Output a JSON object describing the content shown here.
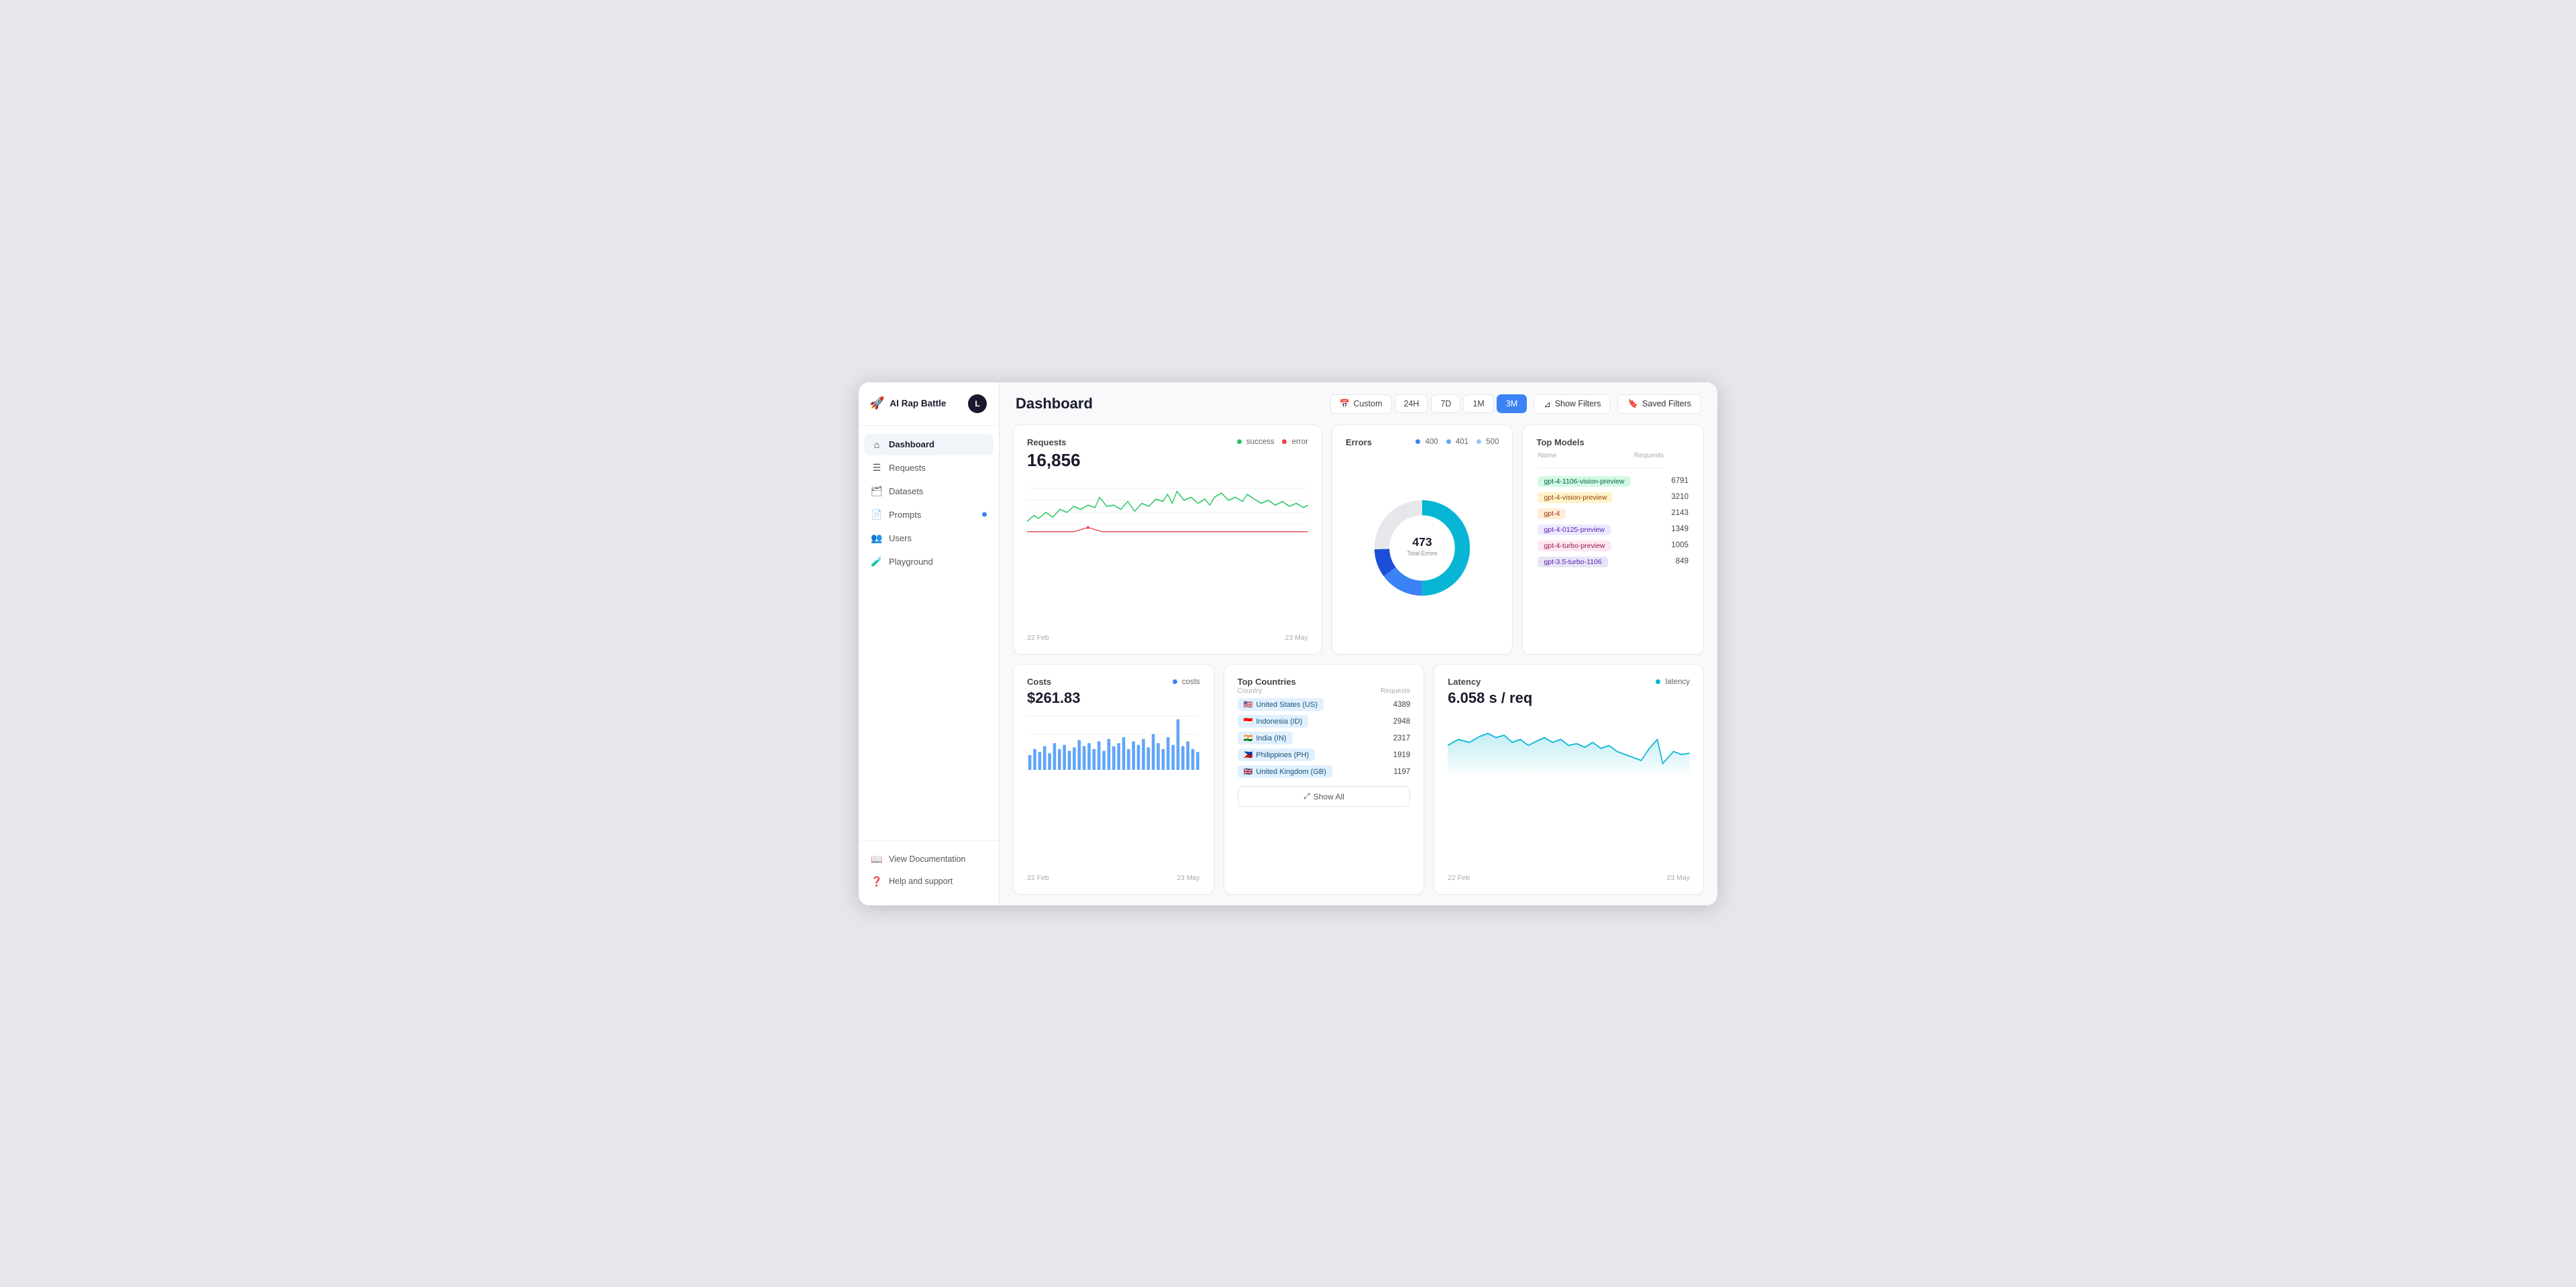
{
  "app": {
    "name": "AI Rap Battle",
    "avatar": "L"
  },
  "sidebar": {
    "nav_items": [
      {
        "id": "dashboard",
        "label": "Dashboard",
        "icon": "🏠",
        "active": true,
        "dot": false
      },
      {
        "id": "requests",
        "label": "Requests",
        "icon": "☰",
        "active": false,
        "dot": false
      },
      {
        "id": "datasets",
        "label": "Datasets",
        "icon": "📁",
        "active": false,
        "dot": false
      },
      {
        "id": "prompts",
        "label": "Prompts",
        "icon": "📄",
        "active": false,
        "dot": true
      },
      {
        "id": "users",
        "label": "Users",
        "icon": "👥",
        "active": false,
        "dot": false
      },
      {
        "id": "playground",
        "label": "Playground",
        "icon": "🧪",
        "active": false,
        "dot": false
      }
    ],
    "footer_items": [
      {
        "id": "docs",
        "label": "View Documentation",
        "icon": "📖"
      },
      {
        "id": "support",
        "label": "Help and support",
        "icon": "❓"
      }
    ]
  },
  "header": {
    "title": "Dashboard",
    "filters": {
      "custom_label": "Custom",
      "options": [
        "24H",
        "7D",
        "1M",
        "3M"
      ],
      "active": "3M"
    },
    "show_filters_label": "Show Filters",
    "saved_filters_label": "Saved Filters"
  },
  "requests_card": {
    "title": "Requests",
    "value": "16,856",
    "legend": [
      {
        "label": "success",
        "color": "#22c55e"
      },
      {
        "label": "error",
        "color": "#ef4444"
      }
    ],
    "date_start": "22 Feb",
    "date_end": "23 May"
  },
  "errors_card": {
    "title": "Errors",
    "legend": [
      {
        "label": "400",
        "color": "#3b82f6"
      },
      {
        "label": "401",
        "color": "#60a5fa"
      },
      {
        "label": "500",
        "color": "#93c5fd"
      }
    ],
    "total": "473",
    "total_label": "Total Errors"
  },
  "top_models_card": {
    "title": "Top Models",
    "col_name": "Name",
    "col_requests": "Requests",
    "models": [
      {
        "name": "gpt-4-1106-vision-preview",
        "count": "6791",
        "color_class": "green"
      },
      {
        "name": "gpt-4-vision-preview",
        "count": "3210",
        "color_class": "yellow"
      },
      {
        "name": "gpt-4",
        "count": "2143",
        "color_class": "orange"
      },
      {
        "name": "gpt-4-0125-preview",
        "count": "1349",
        "color_class": "purple"
      },
      {
        "name": "gpt-4-turbo-preview",
        "count": "1005",
        "color_class": "pink"
      },
      {
        "name": "gpt-3.5-turbo-1106",
        "count": "849",
        "color_class": "lavender"
      }
    ]
  },
  "costs_card": {
    "title": "Costs",
    "legend_label": "costs",
    "legend_color": "#3b82f6",
    "value": "$261.83",
    "date_start": "22 Feb",
    "date_end": "23 May"
  },
  "countries_card": {
    "title": "Top Countries",
    "col_country": "Country",
    "col_requests": "Requests",
    "countries": [
      {
        "flag": "🇺🇸",
        "name": "United States (US)",
        "count": "4389"
      },
      {
        "flag": "🇮🇩",
        "name": "Indonesia (ID)",
        "count": "2948"
      },
      {
        "flag": "🇮🇳",
        "name": "India (IN)",
        "count": "2317"
      },
      {
        "flag": "🇵🇭",
        "name": "Philippines (PH)",
        "count": "1919"
      },
      {
        "flag": "🇬🇧",
        "name": "United Kingdom (GB)",
        "count": "1197"
      }
    ],
    "show_all_label": "Show All"
  },
  "latency_card": {
    "title": "Latency",
    "legend_label": "latency",
    "legend_color": "#06b6d4",
    "value": "6.058 s / req",
    "date_start": "22 Feb",
    "date_end": "23 May"
  }
}
